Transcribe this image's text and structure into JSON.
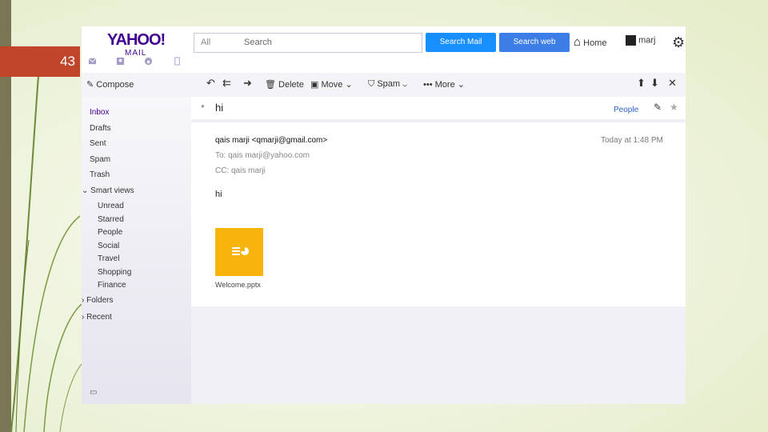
{
  "slide": {
    "number": "43"
  },
  "colors": {
    "accent": "#400090",
    "button": "#188fff",
    "slide_tag": "#c1452b",
    "attachment": "#f6b40c"
  },
  "logo": {
    "text": "YAHOO!",
    "sub": "MAIL"
  },
  "top_icons": [
    "mail-icon",
    "contacts-icon",
    "smiley-icon",
    "notepad-icon"
  ],
  "search": {
    "scope": "All",
    "placeholder": "Search",
    "mail_button": "Search Mail",
    "web_button": "Search web"
  },
  "header": {
    "home": "Home",
    "user": "marj"
  },
  "toolbar": {
    "compose": "Compose",
    "delete": "Delete",
    "move": "Move",
    "spam": "Spam",
    "more": "More"
  },
  "sidebar": {
    "folders": [
      "Inbox",
      "Drafts",
      "Sent",
      "Spam",
      "Trash"
    ],
    "smart_views_label": "Smart views",
    "smart_views": [
      "Unread",
      "Starred",
      "People",
      "Social",
      "Travel",
      "Shopping",
      "Finance"
    ],
    "folders_label": "Folders",
    "recent_label": "Recent"
  },
  "message": {
    "subject": "hi",
    "people_link": "People",
    "from": "qais marji <qmarji@gmail.com>",
    "to": "To: qais marji@yahoo.com",
    "cc": "CC: qais marji",
    "time": "Today at 1:48 PM",
    "body": "hi",
    "attachment_name": "Welcome.pptx"
  }
}
